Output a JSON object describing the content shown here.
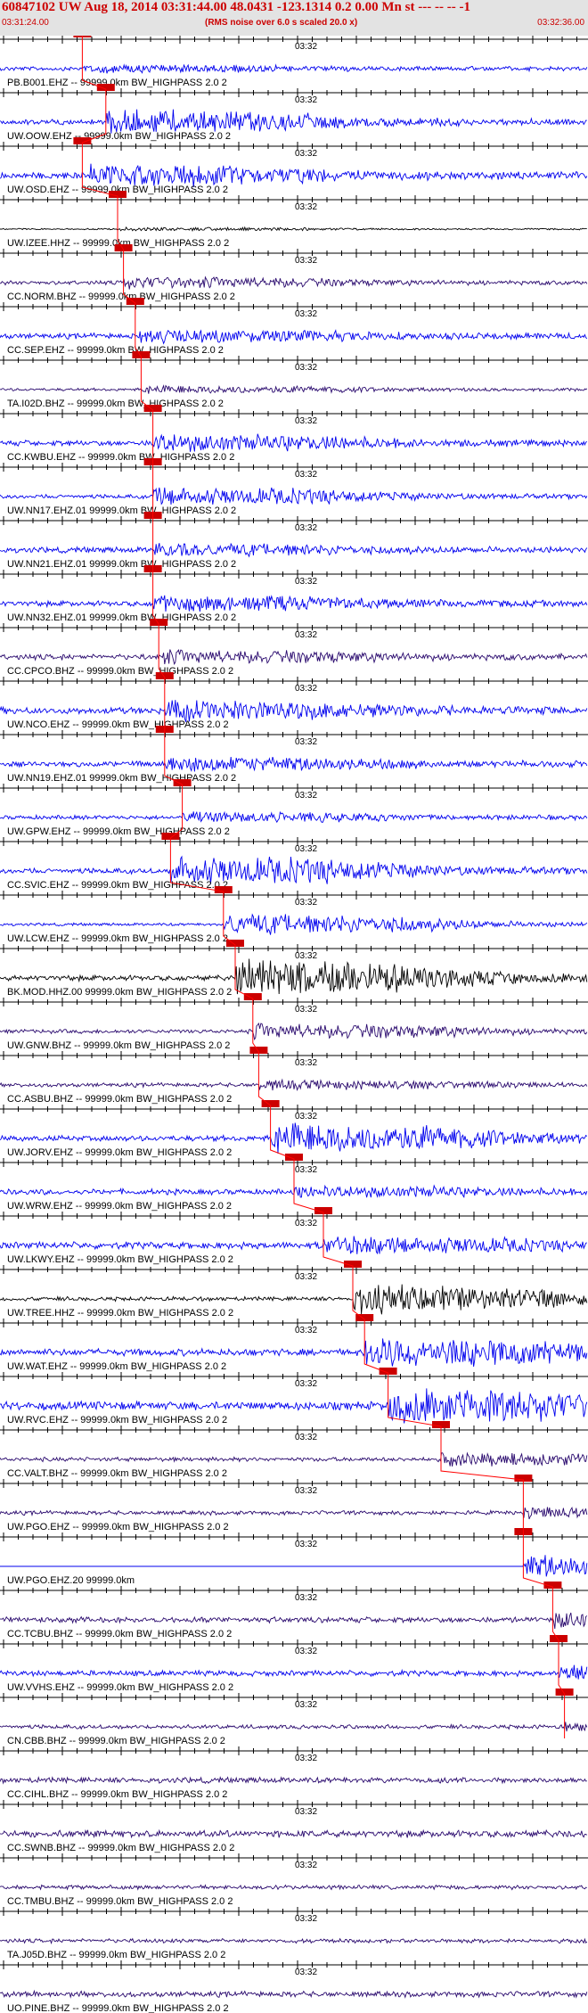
{
  "header": {
    "title": "60847102 UW Aug 18, 2014 03:31:44.00   48.0431 -123.1314  0.2 0.00 Mn st --- -- --   -1",
    "start_time": "03:31:24.00",
    "note": "(RMS noise over 6.0 s scaled 20.0 x)",
    "end_time": "03:32:36.00"
  },
  "time_marker": "03:32",
  "colors": {
    "header_bg": "#e3e3e3",
    "header_text": "#cc0000",
    "pick": "#cc0000",
    "pick_line": "#ff0000",
    "axis": "#000000",
    "trace_blue": "#0000ee",
    "trace_purple": "#2a0a6e",
    "trace_black": "#000000"
  },
  "traces": [
    {
      "label": "PB.B001.EHZ -- 99999.0km BW_HIGHPASS  2.0  2",
      "color": "blue",
      "pick": 0.14,
      "amp": 0.2,
      "noise": 0.15
    },
    {
      "label": "UW.OOW.EHZ -- 99999.0km BW_HIGHPASS  2.0  2",
      "color": "blue",
      "pick": 0.18,
      "amp": 0.8,
      "noise": 0.2
    },
    {
      "label": "UW.OSD.EHZ -- 99999.0km BW_HIGHPASS  2.0  2",
      "color": "blue",
      "pick": 0.14,
      "amp": 0.7,
      "noise": 0.25
    },
    {
      "label": "UW.IZEE.HHZ -- 99999.0km BW_HIGHPASS  2.0  2",
      "color": "black",
      "pick": 0.2,
      "amp": 0.1,
      "noise": 0.05
    },
    {
      "label": "CC.NORM.BHZ -- 99999.0km BW_HIGHPASS  2.0  2",
      "color": "purple",
      "pick": 0.21,
      "amp": 0.35,
      "noise": 0.15
    },
    {
      "label": "CC.SEP.EHZ -- 99999.0km BW_HIGHPASS  2.0  2",
      "color": "blue",
      "pick": 0.23,
      "amp": 0.4,
      "noise": 0.2
    },
    {
      "label": "TA.I02D.BHZ -- 99999.0km BW_HIGHPASS  2.0  2",
      "color": "purple",
      "pick": 0.24,
      "amp": 0.25,
      "noise": 0.1
    },
    {
      "label": "CC.KWBU.EHZ -- 99999.0km BW_HIGHPASS  2.0  2",
      "color": "blue",
      "pick": 0.26,
      "amp": 0.55,
      "noise": 0.2
    },
    {
      "label": "UW.NN17.EHZ.01 99999.0km BW_HIGHPASS  2.0  2",
      "color": "blue",
      "pick": 0.26,
      "amp": 0.6,
      "noise": 0.15
    },
    {
      "label": "UW.NN21.EHZ.01 99999.0km BW_HIGHPASS  2.0  2",
      "color": "blue",
      "pick": 0.26,
      "amp": 0.35,
      "noise": 0.2
    },
    {
      "label": "UW.NN32.EHZ.01 99999.0km BW_HIGHPASS  2.0  2",
      "color": "blue",
      "pick": 0.26,
      "amp": 0.5,
      "noise": 0.2
    },
    {
      "label": "CC.CPCO.BHZ -- 99999.0km BW_HIGHPASS  2.0  2",
      "color": "purple",
      "pick": 0.27,
      "amp": 0.4,
      "noise": 0.2
    },
    {
      "label": "UW.NCO.EHZ -- 99999.0km BW_HIGHPASS  2.0  2",
      "color": "blue",
      "pick": 0.28,
      "amp": 0.6,
      "noise": 0.25
    },
    {
      "label": "UW.NN19.EHZ.01 99999.0km BW_HIGHPASS  2.0  2",
      "color": "blue",
      "pick": 0.28,
      "amp": 0.45,
      "noise": 0.2
    },
    {
      "label": "UW.GPW.EHZ -- 99999.0km BW_HIGHPASS  2.0  2",
      "color": "blue",
      "pick": 0.31,
      "amp": 0.3,
      "noise": 0.15
    },
    {
      "label": "CC.SVIC.EHZ -- 99999.0km BW_HIGHPASS  2.0  2",
      "color": "blue",
      "pick": 0.29,
      "amp": 1.0,
      "noise": 0.2
    },
    {
      "label": "UW.LCW.EHZ -- 99999.0km BW_HIGHPASS  2.0  2",
      "color": "blue",
      "pick": 0.38,
      "amp": 0.8,
      "noise": 0.1
    },
    {
      "label": "BK.MOD.HHZ.00 99999.0km BW_HIGHPASS  2.0  2",
      "color": "black",
      "pick": 0.4,
      "amp": 1.3,
      "noise": 0.2
    },
    {
      "label": "UW.GNW.BHZ -- 99999.0km BW_HIGHPASS  2.0  2",
      "color": "purple",
      "pick": 0.43,
      "amp": 0.5,
      "noise": 0.15
    },
    {
      "label": "CC.ASBU.BHZ -- 99999.0km BW_HIGHPASS  2.0  2",
      "color": "purple",
      "pick": 0.44,
      "amp": 0.25,
      "noise": 0.15
    },
    {
      "label": "UW.JORV.EHZ -- 99999.0km BW_HIGHPASS  2.0  2",
      "color": "blue",
      "pick": 0.46,
      "amp": 1.1,
      "noise": 0.2
    },
    {
      "label": "UW.WRW.EHZ -- 99999.0km BW_HIGHPASS  2.0  2",
      "color": "blue",
      "pick": 0.5,
      "amp": 0.3,
      "noise": 0.2
    },
    {
      "label": "UW.LKWY.EHZ -- 99999.0km BW_HIGHPASS  2.0  2",
      "color": "blue",
      "pick": 0.55,
      "amp": 0.5,
      "noise": 0.25
    },
    {
      "label": "UW.TREE.HHZ -- 99999.0km BW_HIGHPASS  2.0  2",
      "color": "black",
      "pick": 0.6,
      "amp": 1.0,
      "noise": 0.15
    },
    {
      "label": "UW.WAT.EHZ -- 99999.0km BW_HIGHPASS  2.0  2",
      "color": "blue",
      "pick": 0.62,
      "amp": 1.0,
      "noise": 0.25
    },
    {
      "label": "UW.RVC.EHZ -- 99999.0km BW_HIGHPASS  2.0  2",
      "color": "blue",
      "pick": 0.66,
      "amp": 1.2,
      "noise": 0.3
    },
    {
      "label": "CC.VALT.BHZ -- 99999.0km BW_HIGHPASS  2.0  2",
      "color": "purple",
      "pick": 0.75,
      "amp": 0.4,
      "noise": 0.15
    },
    {
      "label": "UW.PGO.EHZ -- 99999.0km BW_HIGHPASS  2.0  2",
      "color": "purple",
      "pick": 0.89,
      "amp": 0.3,
      "noise": 0.15
    },
    {
      "label": "UW.PGO.EHZ.20 99999.0km",
      "color": "blue",
      "pick": 0.89,
      "amp": 0.9,
      "noise": 0.0
    },
    {
      "label": "CC.TCBU.BHZ -- 99999.0km BW_HIGHPASS  2.0  2",
      "color": "purple",
      "pick": 0.94,
      "amp": 0.5,
      "noise": 0.2
    },
    {
      "label": "UW.VVHS.EHZ -- 99999.0km BW_HIGHPASS  2.0  2",
      "color": "blue",
      "pick": 0.95,
      "amp": 0.6,
      "noise": 0.2
    },
    {
      "label": "CN.CBB.BHZ -- 99999.0km BW_HIGHPASS  2.0  2",
      "color": "purple",
      "pick": 0.96,
      "amp": 0.2,
      "noise": 0.15
    },
    {
      "label": "CC.CIHL.BHZ -- 99999.0km BW_HIGHPASS  2.0  2",
      "color": "purple",
      "pick": null,
      "amp": 0.0,
      "noise": 0.2
    },
    {
      "label": "CC.SWNB.BHZ -- 99999.0km BW_HIGHPASS  2.0  2",
      "color": "purple",
      "pick": null,
      "amp": 0.0,
      "noise": 0.25
    },
    {
      "label": "CC.TMBU.BHZ -- 99999.0km BW_HIGHPASS  2.0  2",
      "color": "purple",
      "pick": null,
      "amp": 0.0,
      "noise": 0.15
    },
    {
      "label": "TA.J05D.BHZ -- 99999.0km BW_HIGHPASS  2.0  2",
      "color": "purple",
      "pick": null,
      "amp": 0.0,
      "noise": 0.15
    },
    {
      "label": "UO.PINE.BHZ -- 99999.0km BW_HIGHPASS  2.0  2",
      "color": "purple",
      "pick": null,
      "amp": 0.0,
      "noise": 0.2
    }
  ]
}
